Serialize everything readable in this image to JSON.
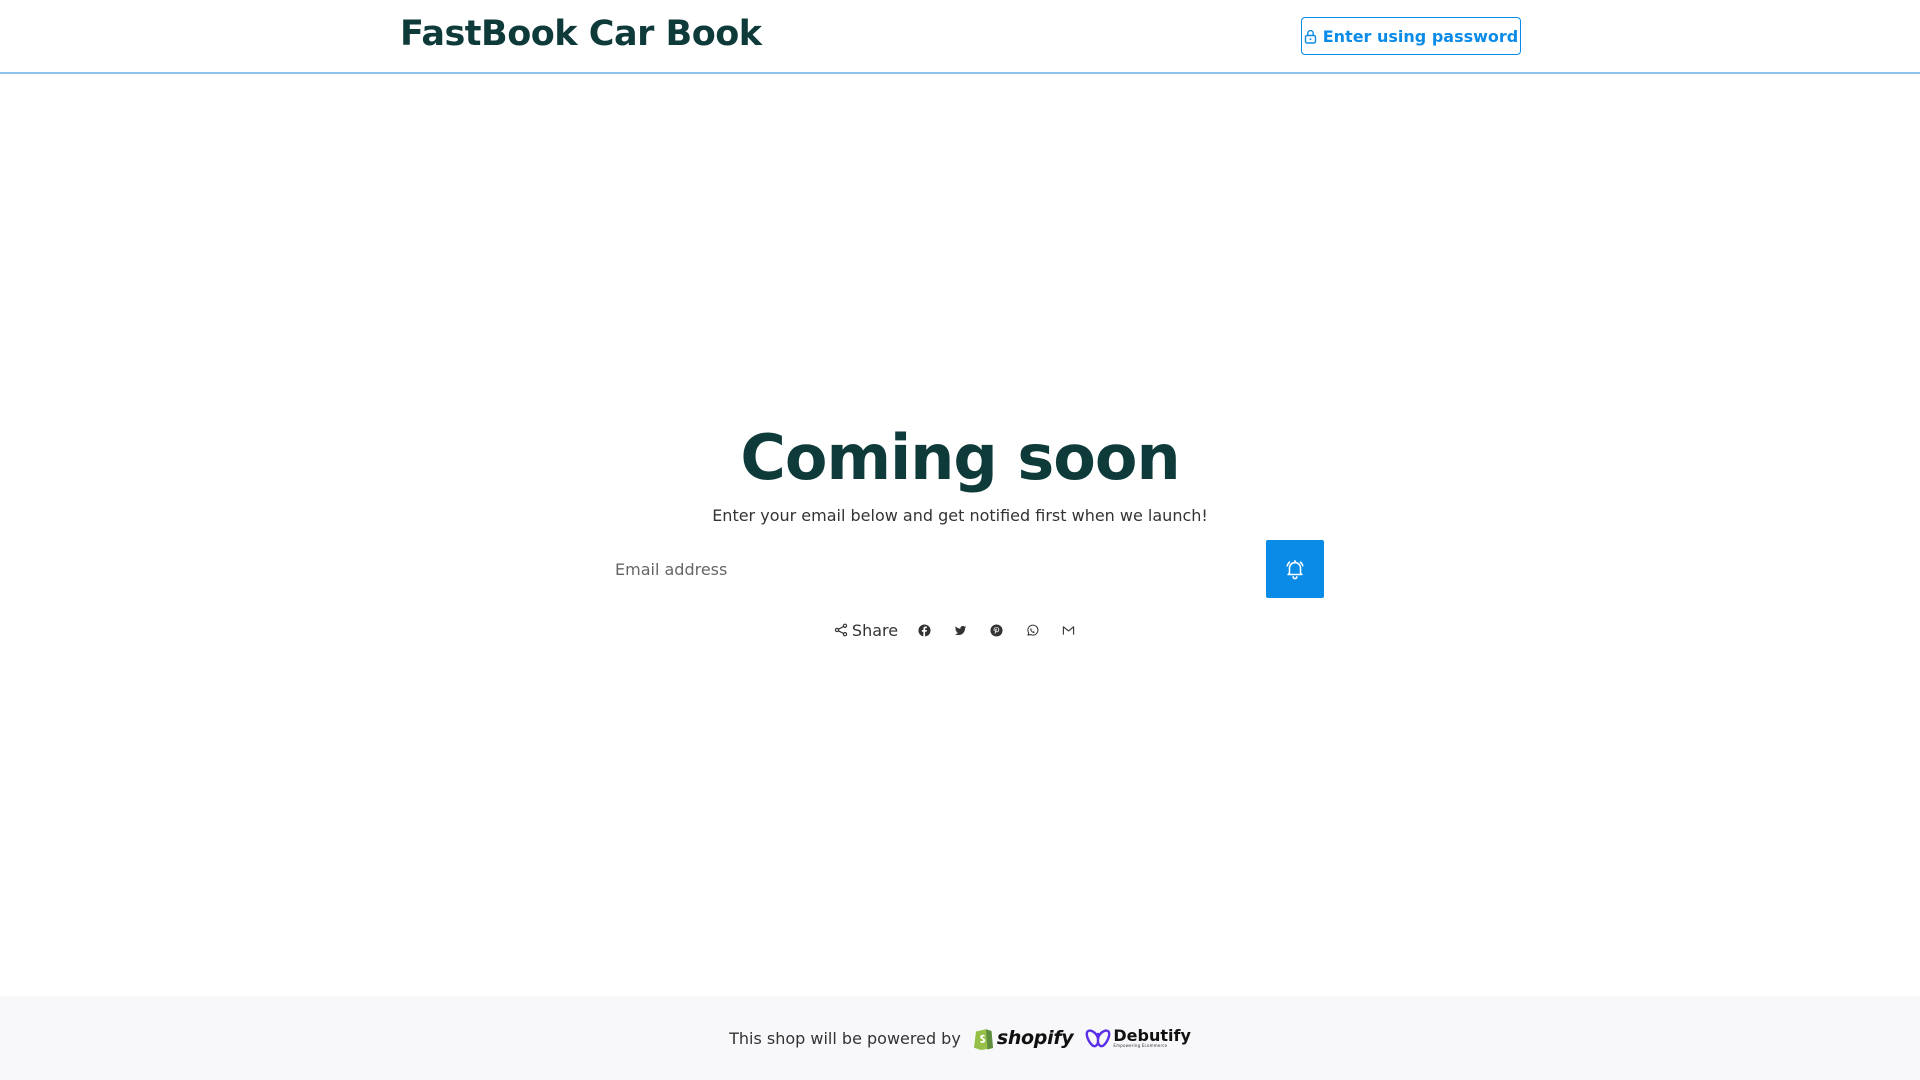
{
  "header": {
    "brand": "FastBook Car Book",
    "password_button_label": "Enter using password"
  },
  "main": {
    "title": "Coming soon",
    "subtitle": "Enter your email below and get notified first when we launch!",
    "email_placeholder": "Email address",
    "share_label": "Share"
  },
  "footer": {
    "powered_text": "This shop will be powered by",
    "shopify_label": "shopify",
    "debutify_label": "Debutify",
    "debutify_tagline": "Empowering Ecommerce"
  },
  "icons": [
    "lock-icon",
    "bell-icon",
    "share-icon",
    "facebook-icon",
    "twitter-icon",
    "pinterest-icon",
    "whatsapp-icon",
    "email-icon",
    "shopify-bag-icon",
    "debutify-butterfly-icon"
  ],
  "colors": {
    "brand_text": "#0e3a3a",
    "accent": "#0a8be8",
    "header_border": "#8cc4ec",
    "footer_bg": "#f8f8fa",
    "shopify_green": "#95bf47",
    "debutify_purple": "#5b2ee8"
  }
}
